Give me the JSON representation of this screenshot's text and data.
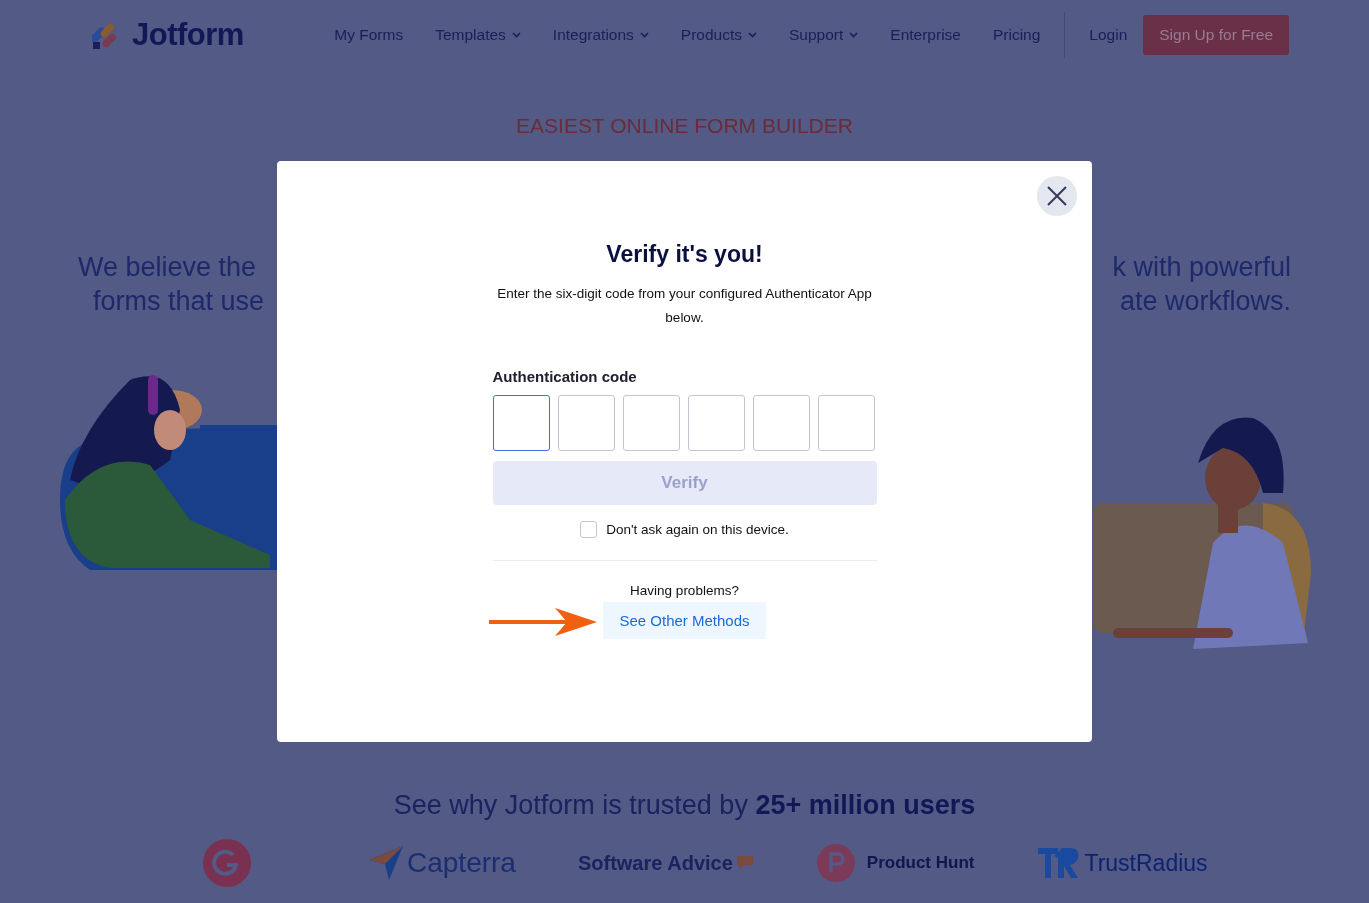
{
  "header": {
    "logo": "Jotform",
    "nav": [
      {
        "label": "My Forms",
        "dropdown": false
      },
      {
        "label": "Templates",
        "dropdown": true
      },
      {
        "label": "Integrations",
        "dropdown": true
      },
      {
        "label": "Products",
        "dropdown": true
      },
      {
        "label": "Support",
        "dropdown": true
      },
      {
        "label": "Enterprise",
        "dropdown": false
      },
      {
        "label": "Pricing",
        "dropdown": false
      }
    ],
    "login": "Login",
    "signup": "Sign Up for Free"
  },
  "tagline": "EASIEST ONLINE FORM BUILDER",
  "hero": {
    "left_lines": [
      "We believe the",
      "forms that use"
    ],
    "right_lines": [
      "k with powerful",
      "ate workflows."
    ]
  },
  "modal": {
    "title": "Verify it's you!",
    "description": "Enter the six-digit code from your configured Authenticator App below.",
    "code_label": "Authentication code",
    "code_boxes": [
      {
        "selected": true
      },
      {
        "selected": false
      },
      {
        "selected": false
      },
      {
        "selected": false
      },
      {
        "selected": false
      },
      {
        "selected": false
      }
    ],
    "verify": {
      "label": "Verify",
      "disabled": true
    },
    "remember": {
      "label": "Don't ask again on this device.",
      "checked": false
    },
    "problems": "Having problems?",
    "other_methods": "See Other Methods"
  },
  "trusted": {
    "text": "See why Jotform is trusted by **25+ million users**",
    "logos": [
      {
        "kind": "g2"
      },
      {
        "kind": "capterra",
        "name": "Capterra"
      },
      {
        "kind": "softwareadvice",
        "name": "Software Advice"
      },
      {
        "kind": "producthunt",
        "name": "Product Hunt"
      },
      {
        "kind": "trustradius",
        "name": "TrustRadius"
      }
    ]
  }
}
